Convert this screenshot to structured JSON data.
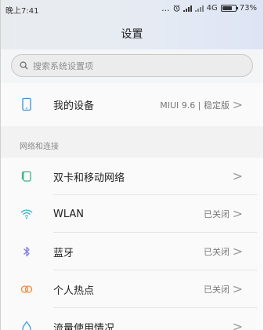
{
  "status_bar": {
    "time": "晚上7:41",
    "more": "...",
    "alarm_icon": "alarm-icon",
    "network": "4G",
    "battery_percent_text": "73%",
    "battery_level": 0.73
  },
  "header": {
    "title": "设置"
  },
  "search": {
    "placeholder": "搜索系统设置项"
  },
  "device_row": {
    "label": "我的设备",
    "value": "MIUI 9.6 | 稳定版"
  },
  "section": {
    "label": "网络和连接"
  },
  "network_rows": [
    {
      "label": "双卡和移动网络",
      "value": "",
      "icon": "sim-card-icon",
      "color": "#3cb08a"
    },
    {
      "label": "WLAN",
      "value": "已关闭",
      "icon": "wifi-icon",
      "color": "#2bb3c8"
    },
    {
      "label": "蓝牙",
      "value": "已关闭",
      "icon": "bluetooth-icon",
      "color": "#8a7fe0"
    },
    {
      "label": "个人热点",
      "value": "已关闭",
      "icon": "hotspot-icon",
      "color": "#f08a3c"
    },
    {
      "label": "流量使用情况",
      "value": "",
      "icon": "data-usage-icon",
      "color": "#3aa0e0"
    }
  ],
  "chevron": ">"
}
